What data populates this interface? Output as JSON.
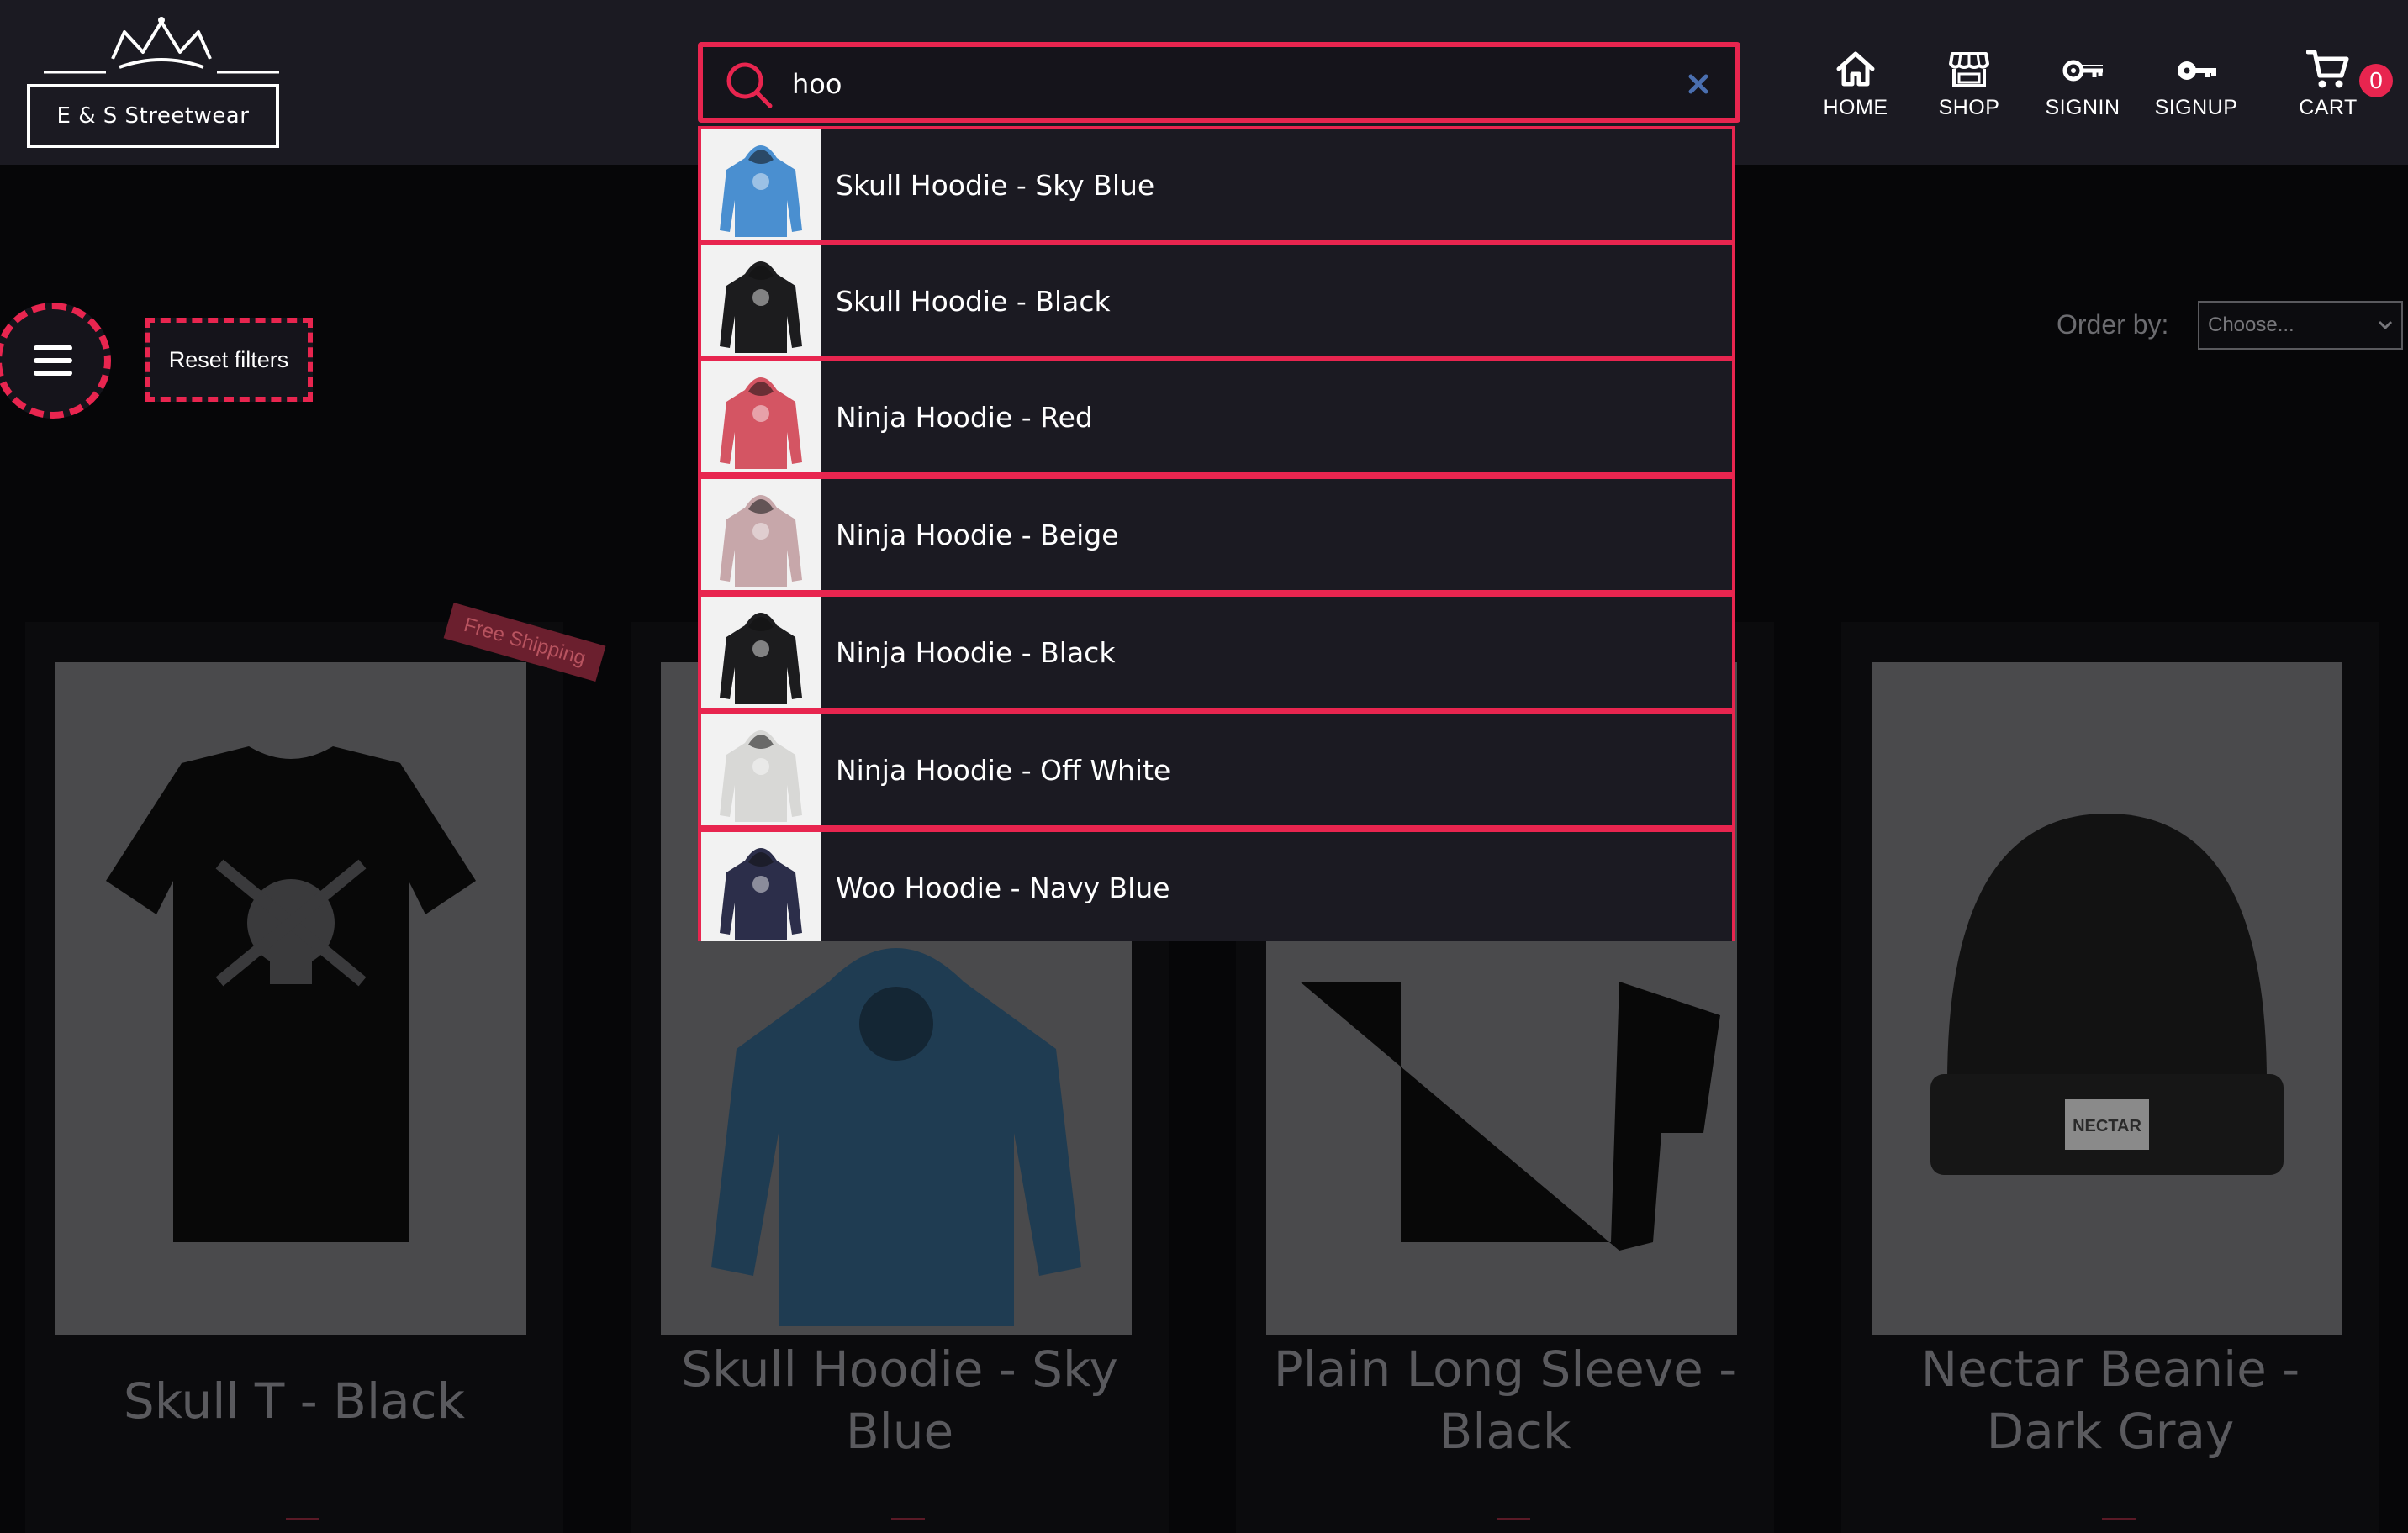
{
  "brand": {
    "name": "E & S Streetwear"
  },
  "search": {
    "value": "hoo"
  },
  "nav": [
    {
      "label": "HOME",
      "icon": "home-icon"
    },
    {
      "label": "SHOP",
      "icon": "shop-icon"
    },
    {
      "label": "SIGNIN",
      "icon": "key-icon"
    },
    {
      "label": "SIGNUP",
      "icon": "key-icon"
    },
    {
      "label": "CART",
      "icon": "cart-icon"
    }
  ],
  "cart": {
    "count": "0"
  },
  "filters": {
    "reset_label": "Reset filters"
  },
  "order": {
    "label": "Order by:",
    "selected": "Choose..."
  },
  "suggestions": [
    {
      "label": "Skull Hoodie - Sky Blue",
      "color": "#4a8fd0"
    },
    {
      "label": "Skull Hoodie - Black",
      "color": "#1c1c1e"
    },
    {
      "label": "Ninja Hoodie - Red",
      "color": "#d45563"
    },
    {
      "label": "Ninja Hoodie - Beige",
      "color": "#c7a7aa"
    },
    {
      "label": "Ninja Hoodie - Black",
      "color": "#1c1c1e"
    },
    {
      "label": "Ninja Hoodie - Off White",
      "color": "#d8d8d6"
    },
    {
      "label": "Woo Hoodie - Navy Blue",
      "color": "#2c2e4a"
    }
  ],
  "products": [
    {
      "title_lines": [
        "Skull T - Black"
      ],
      "badge": "Free Shipping"
    },
    {
      "title_lines": [
        "Skull Hoodie - Sky",
        "Blue"
      ]
    },
    {
      "title_lines": [
        "Plain Long Sleeve -",
        "Black"
      ]
    },
    {
      "title_lines": [
        "Nectar Beanie -",
        "Dark Gray"
      ]
    }
  ],
  "colors": {
    "accent": "#e8254f",
    "header_bg": "#1b1a22",
    "page_bg": "#060608"
  }
}
